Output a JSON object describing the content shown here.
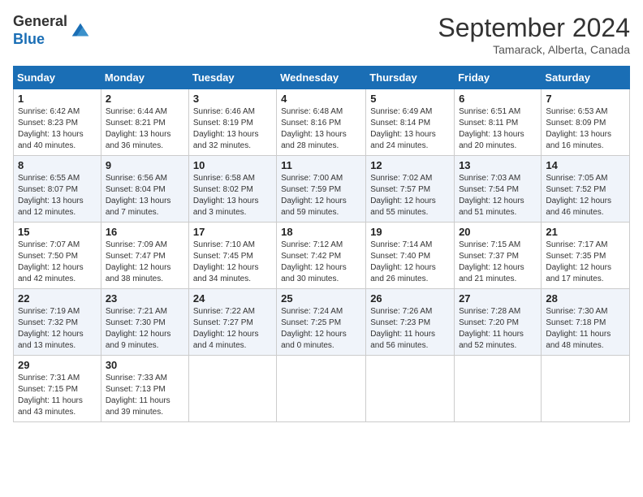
{
  "header": {
    "logo_line1": "General",
    "logo_line2": "Blue",
    "month_year": "September 2024",
    "location": "Tamarack, Alberta, Canada"
  },
  "calendar": {
    "days_of_week": [
      "Sunday",
      "Monday",
      "Tuesday",
      "Wednesday",
      "Thursday",
      "Friday",
      "Saturday"
    ],
    "weeks": [
      [
        {
          "day": "1",
          "sunrise": "6:42 AM",
          "sunset": "8:23 PM",
          "daylight": "13 hours and 40 minutes."
        },
        {
          "day": "2",
          "sunrise": "6:44 AM",
          "sunset": "8:21 PM",
          "daylight": "13 hours and 36 minutes."
        },
        {
          "day": "3",
          "sunrise": "6:46 AM",
          "sunset": "8:19 PM",
          "daylight": "13 hours and 32 minutes."
        },
        {
          "day": "4",
          "sunrise": "6:48 AM",
          "sunset": "8:16 PM",
          "daylight": "13 hours and 28 minutes."
        },
        {
          "day": "5",
          "sunrise": "6:49 AM",
          "sunset": "8:14 PM",
          "daylight": "13 hours and 24 minutes."
        },
        {
          "day": "6",
          "sunrise": "6:51 AM",
          "sunset": "8:11 PM",
          "daylight": "13 hours and 20 minutes."
        },
        {
          "day": "7",
          "sunrise": "6:53 AM",
          "sunset": "8:09 PM",
          "daylight": "13 hours and 16 minutes."
        }
      ],
      [
        {
          "day": "8",
          "sunrise": "6:55 AM",
          "sunset": "8:07 PM",
          "daylight": "13 hours and 12 minutes."
        },
        {
          "day": "9",
          "sunrise": "6:56 AM",
          "sunset": "8:04 PM",
          "daylight": "13 hours and 7 minutes."
        },
        {
          "day": "10",
          "sunrise": "6:58 AM",
          "sunset": "8:02 PM",
          "daylight": "13 hours and 3 minutes."
        },
        {
          "day": "11",
          "sunrise": "7:00 AM",
          "sunset": "7:59 PM",
          "daylight": "12 hours and 59 minutes."
        },
        {
          "day": "12",
          "sunrise": "7:02 AM",
          "sunset": "7:57 PM",
          "daylight": "12 hours and 55 minutes."
        },
        {
          "day": "13",
          "sunrise": "7:03 AM",
          "sunset": "7:54 PM",
          "daylight": "12 hours and 51 minutes."
        },
        {
          "day": "14",
          "sunrise": "7:05 AM",
          "sunset": "7:52 PM",
          "daylight": "12 hours and 46 minutes."
        }
      ],
      [
        {
          "day": "15",
          "sunrise": "7:07 AM",
          "sunset": "7:50 PM",
          "daylight": "12 hours and 42 minutes."
        },
        {
          "day": "16",
          "sunrise": "7:09 AM",
          "sunset": "7:47 PM",
          "daylight": "12 hours and 38 minutes."
        },
        {
          "day": "17",
          "sunrise": "7:10 AM",
          "sunset": "7:45 PM",
          "daylight": "12 hours and 34 minutes."
        },
        {
          "day": "18",
          "sunrise": "7:12 AM",
          "sunset": "7:42 PM",
          "daylight": "12 hours and 30 minutes."
        },
        {
          "day": "19",
          "sunrise": "7:14 AM",
          "sunset": "7:40 PM",
          "daylight": "12 hours and 26 minutes."
        },
        {
          "day": "20",
          "sunrise": "7:15 AM",
          "sunset": "7:37 PM",
          "daylight": "12 hours and 21 minutes."
        },
        {
          "day": "21",
          "sunrise": "7:17 AM",
          "sunset": "7:35 PM",
          "daylight": "12 hours and 17 minutes."
        }
      ],
      [
        {
          "day": "22",
          "sunrise": "7:19 AM",
          "sunset": "7:32 PM",
          "daylight": "12 hours and 13 minutes."
        },
        {
          "day": "23",
          "sunrise": "7:21 AM",
          "sunset": "7:30 PM",
          "daylight": "12 hours and 9 minutes."
        },
        {
          "day": "24",
          "sunrise": "7:22 AM",
          "sunset": "7:27 PM",
          "daylight": "12 hours and 4 minutes."
        },
        {
          "day": "25",
          "sunrise": "7:24 AM",
          "sunset": "7:25 PM",
          "daylight": "12 hours and 0 minutes."
        },
        {
          "day": "26",
          "sunrise": "7:26 AM",
          "sunset": "7:23 PM",
          "daylight": "11 hours and 56 minutes."
        },
        {
          "day": "27",
          "sunrise": "7:28 AM",
          "sunset": "7:20 PM",
          "daylight": "11 hours and 52 minutes."
        },
        {
          "day": "28",
          "sunrise": "7:30 AM",
          "sunset": "7:18 PM",
          "daylight": "11 hours and 48 minutes."
        }
      ],
      [
        {
          "day": "29",
          "sunrise": "7:31 AM",
          "sunset": "7:15 PM",
          "daylight": "11 hours and 43 minutes."
        },
        {
          "day": "30",
          "sunrise": "7:33 AM",
          "sunset": "7:13 PM",
          "daylight": "11 hours and 39 minutes."
        },
        null,
        null,
        null,
        null,
        null
      ]
    ]
  }
}
